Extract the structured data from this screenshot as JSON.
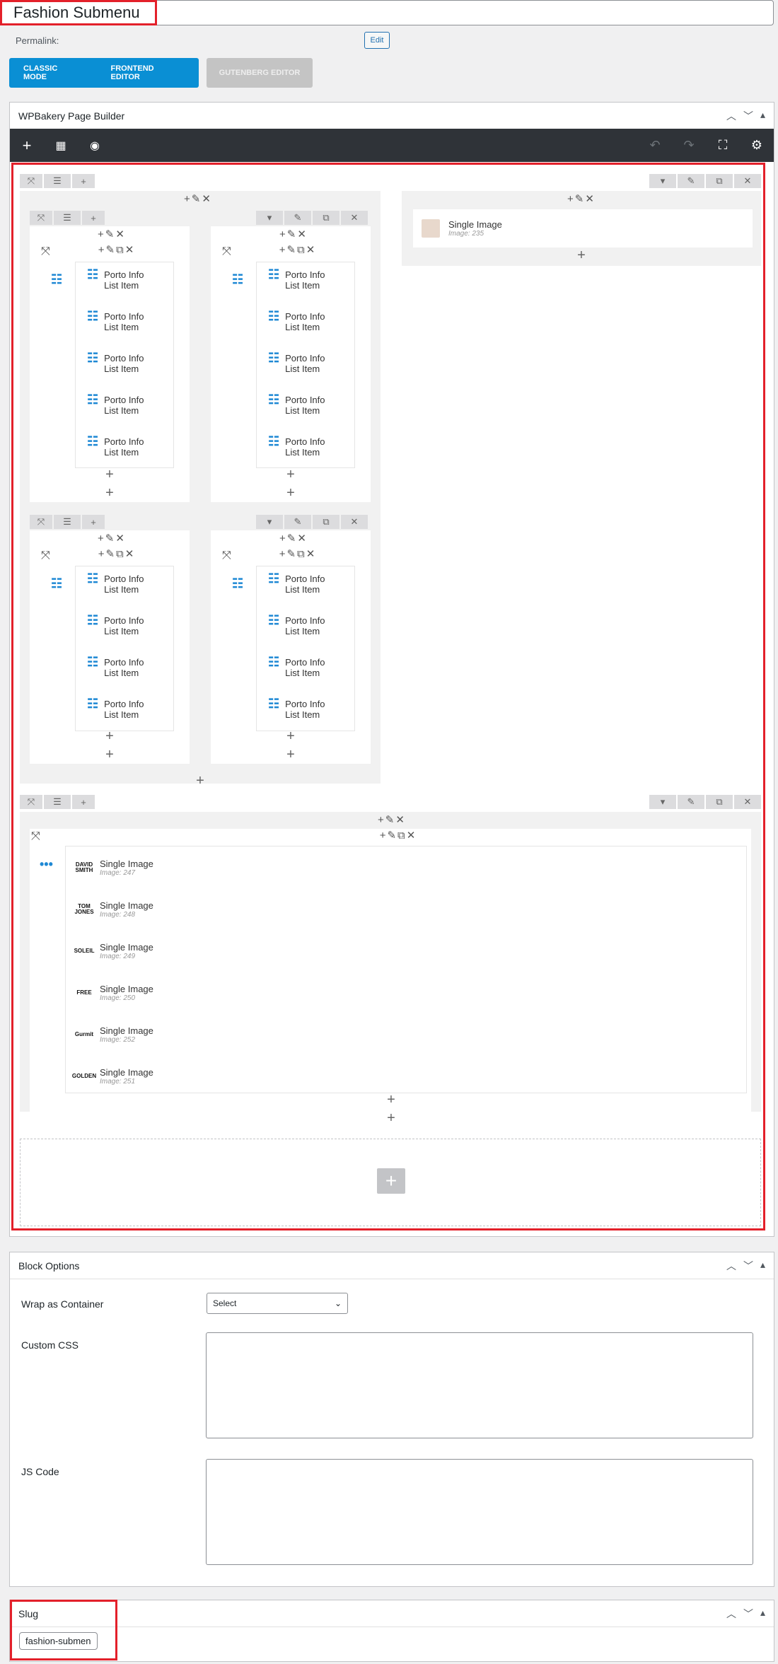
{
  "post_title": "Fashion Submenu",
  "permalink": {
    "label": "Permalink:",
    "edit": "Edit"
  },
  "modes": {
    "classic": "CLASSIC MODE",
    "frontend": "FRONTEND EDITOR",
    "gutenberg": "GUTENBERG EDITOR"
  },
  "builder": {
    "title": "WPBakery Page Builder"
  },
  "list_item_label_1": "Porto Info",
  "list_item_label_2": "List Item",
  "single_image": {
    "label": "Single Image",
    "top_right_sub": "Image: 235"
  },
  "brand_images": [
    {
      "label": "Single Image",
      "sub": "Image: 247",
      "logo": "DAVID SMITH"
    },
    {
      "label": "Single Image",
      "sub": "Image: 248",
      "logo": "TOM JONES"
    },
    {
      "label": "Single Image",
      "sub": "Image: 249",
      "logo": "SOLEIL"
    },
    {
      "label": "Single Image",
      "sub": "Image: 250",
      "logo": "FREE"
    },
    {
      "label": "Single Image",
      "sub": "Image: 252",
      "logo": "Gurmit"
    },
    {
      "label": "Single Image",
      "sub": "Image: 251",
      "logo": "GOLDEN"
    }
  ],
  "block_options": {
    "title": "Block Options",
    "wrap_label": "Wrap as Container",
    "wrap_value": "Select",
    "css_label": "Custom CSS",
    "js_label": "JS Code"
  },
  "slug": {
    "title": "Slug",
    "value": "fashion-submen"
  }
}
